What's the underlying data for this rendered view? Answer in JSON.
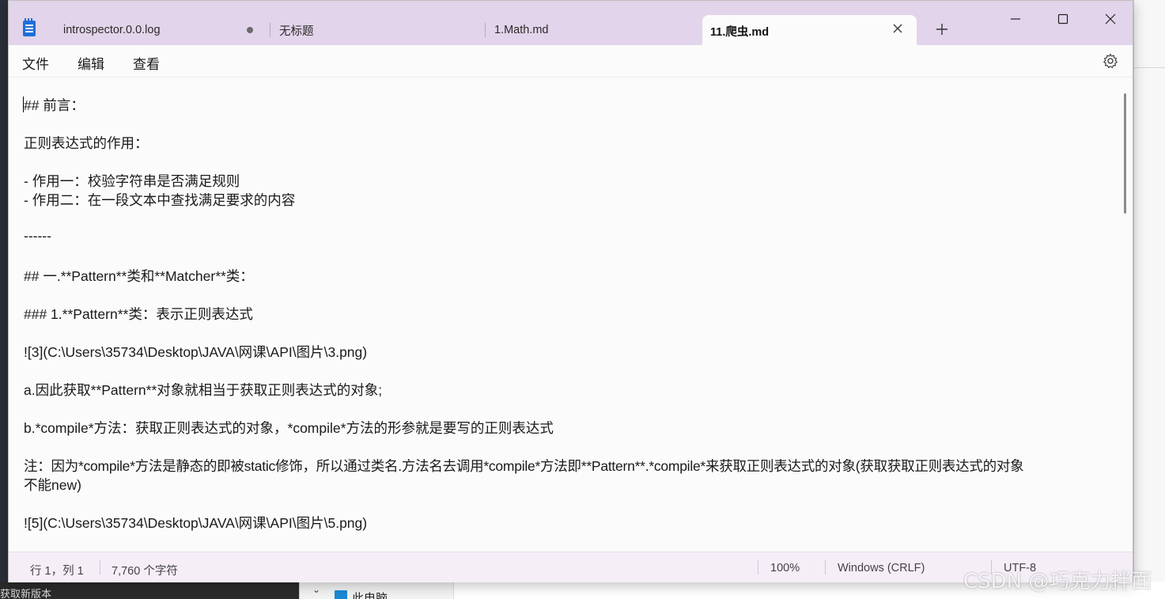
{
  "window": {
    "tabs": [
      {
        "label": "introspector.0.0.log",
        "unsaved": true
      },
      {
        "label": "无标题"
      },
      {
        "label": "1.Math.md"
      },
      {
        "label": "11.爬虫.md",
        "active": true
      }
    ]
  },
  "menu": {
    "file": "文件",
    "edit": "编辑",
    "view": "查看"
  },
  "editor": {
    "lines": [
      "## 前言：",
      "正则表达式的作用：",
      "- 作用一：校验字符串是否满足规则",
      "- 作用二：在一段文本中查找满足要求的内容",
      "------",
      "## 一.**Pattern**类和**Matcher**类：",
      "### 1.**Pattern**类：表示正则表达式",
      "![3](C:\\Users\\35734\\Desktop\\JAVA\\网课\\API\\图片\\3.png)",
      "a.因此获取**Pattern**对象就相当于获取正则表达式的对象;",
      "b.*compile*方法：获取正则表达式的对象，*compile*方法的形参就是要写的正则表达式",
      "注：因为*compile*方法是静态的即被static修饰，所以通过类名.方法名去调用*compile*方法即**Pattern**.*compile*来获取正则表达式的对象(获取获取正则表达式的对象",
      "不能new)",
      "![5](C:\\Users\\35734\\Desktop\\JAVA\\网课\\API\\图片\\5.png)"
    ]
  },
  "status": {
    "position": "行 1，列 1",
    "chars": "7,760 个字符",
    "zoom": "100%",
    "line_ending": "Windows (CRLF)",
    "encoding": "UTF-8"
  },
  "desktop": {
    "taskbar_text": "获取新版本",
    "explorer_item": "此电脑"
  },
  "watermark": "CSDN @巧克力拌面",
  "colors": {
    "titlebar": "#e2d4ea",
    "statusbar": "#f5eef7",
    "editor_bg": "#fbfbfb"
  }
}
